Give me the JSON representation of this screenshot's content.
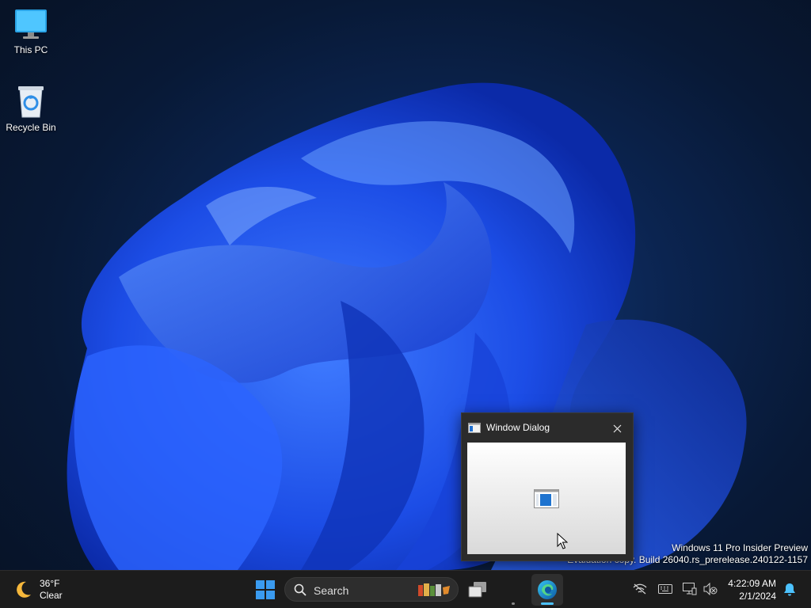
{
  "desktop": {
    "icons": [
      {
        "label": "This PC",
        "icon": "monitor-icon"
      },
      {
        "label": "Recycle Bin",
        "icon": "recycle-bin-icon"
      }
    ],
    "watermark": {
      "line1": "Windows 11 Pro Insider Preview",
      "line2": "Evaluation copy. Build 26040.rs_prerelease.240122-1157"
    }
  },
  "dialog": {
    "title": "Window Dialog",
    "close_icon": "close-icon",
    "content_icon": "window-app-icon"
  },
  "taskbar": {
    "weather": {
      "temp": "36°F",
      "condition": "Clear",
      "icon": "moon-icon"
    },
    "search": {
      "placeholder": "Search"
    },
    "apps": [
      "start-icon",
      "search",
      "task-view-icon",
      "edge-icon"
    ],
    "tray_icons": [
      "network-off-icon",
      "keyboard-icon",
      "display-icon",
      "volume-muted-icon",
      "notification-bell-icon"
    ],
    "clock": {
      "time": "4:22:09 AM",
      "date": "2/1/2024"
    }
  },
  "colors": {
    "accent": "#4cc2ff",
    "taskbar": "#1c1c1c",
    "wallpaper_blue": "#1a4fe0"
  }
}
